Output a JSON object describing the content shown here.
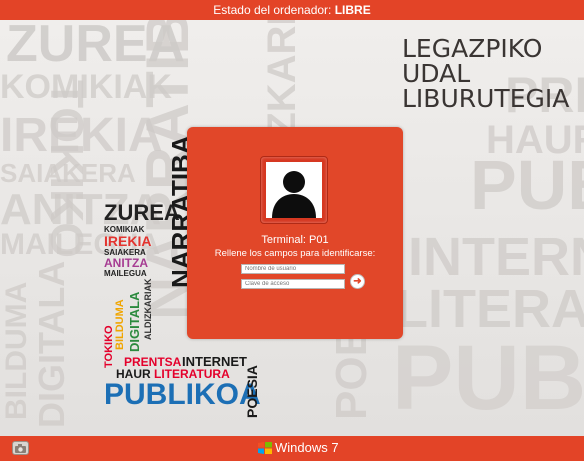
{
  "status_bar": {
    "label": "Estado del ordenador: ",
    "status": "LIBRE"
  },
  "library": {
    "line1": "LEGAZPIKO",
    "line2": "UDAL",
    "line3": "LIBURUTEGIA"
  },
  "background_words": [
    "ZUREA",
    "KOMIKIAK",
    "IREKIA",
    "SAIAKERA",
    "ANITZA",
    "MAILEGUA",
    "BILDUMA",
    "DIGITALA",
    "ALDIZKARIAK",
    "NARRATIBA",
    "PRENTSA",
    "HAUR",
    "PUBLIKOA",
    "INTERNET",
    "LITERATURA",
    "POESIA",
    "TOKIKO"
  ],
  "poster": {
    "zurea": "ZUREA",
    "komikiak": "KOMIKIAK",
    "irekia": "IREKIA",
    "saiakera": "SAIAKERA",
    "anitza": "ANITZA",
    "mailegua": "MAILEGUA",
    "narratiba": "NARRATIBA",
    "tokiko": "TOKIKO",
    "bilduma": "BILDUMA",
    "digitala": "DIGITALA",
    "aldizkariak": "ALDIZKARIAK",
    "prentsa": "PRENTSA",
    "internet": "INTERNET",
    "haur": "HAUR",
    "literatura": "LITERATURA",
    "publikoa": "PUBLIKOA",
    "poesia": "POESIA"
  },
  "login": {
    "terminal": "Terminal: P01",
    "prompt": "Rellene los campos para identificarse:",
    "username_placeholder": "Nombre de usuario",
    "password_placeholder": "Clave de acceso",
    "submit_icon": "arrow-right-icon",
    "avatar_icon": "user-silhouette-icon"
  },
  "taskbar": {
    "brand": "Windows 7"
  },
  "colors": {
    "accent": "#e34427",
    "panel": "#e14729"
  }
}
